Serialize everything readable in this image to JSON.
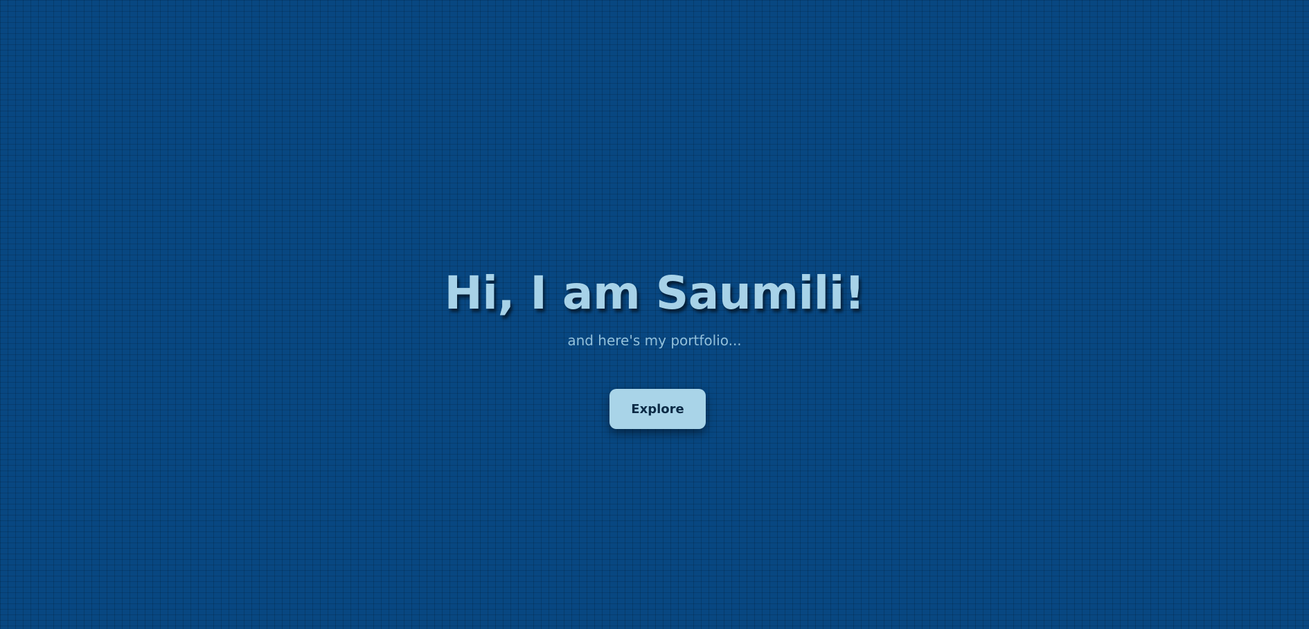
{
  "hero": {
    "title": "Hi, I am Saumili!",
    "subtitle": "and here's my portfolio...",
    "button_label": "Explore"
  },
  "colors": {
    "background": "#084781",
    "title": "#a7d2e8",
    "subtitle": "#93c0da",
    "button_background": "#a9d4e8",
    "button_text": "#0b2a45"
  }
}
